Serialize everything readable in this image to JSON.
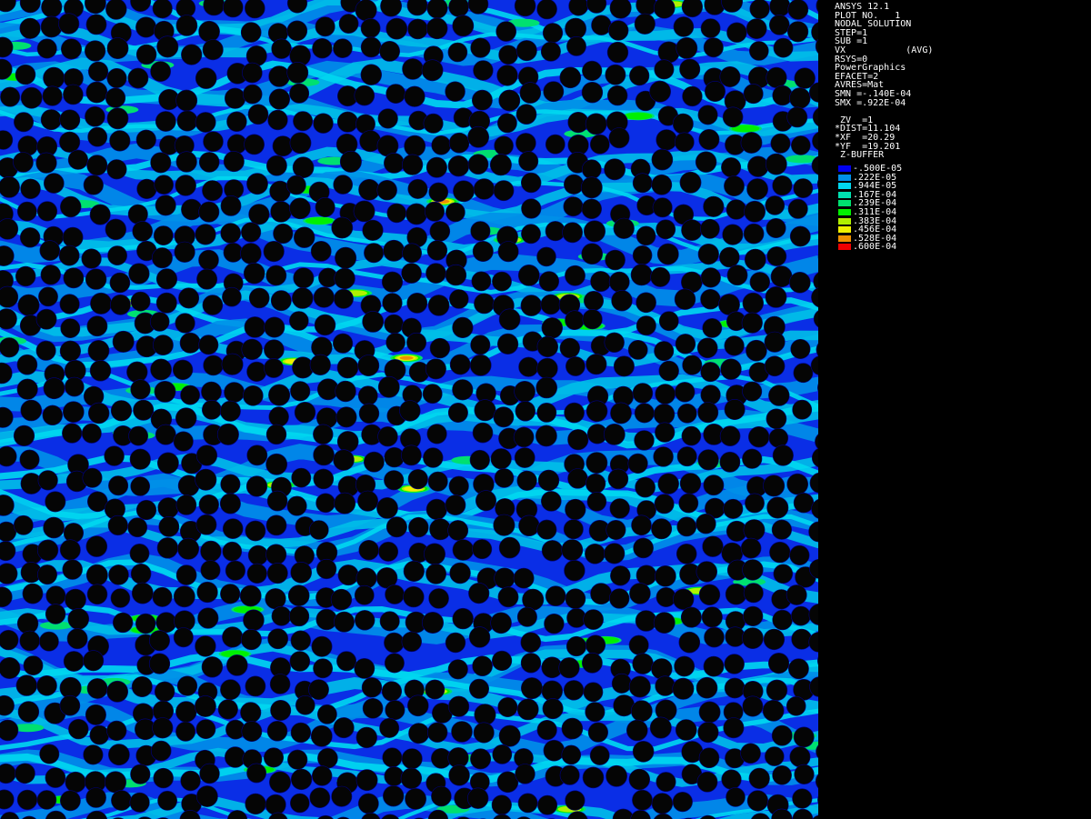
{
  "info": {
    "lines1": [
      "ANSYS 12.1",
      "PLOT NO.   1",
      "NODAL SOLUTION",
      "STEP=1",
      "SUB =1",
      "VX           (AVG)",
      "RSYS=0",
      "PowerGraphics",
      "EFACET=2",
      "AVRES=Mat",
      "SMN =-.140E-04",
      "SMX =.922E-04"
    ],
    "lines2": [
      " ZV  =1",
      "*DIST=11.104",
      "*XF  =20.29",
      "*YF  =19.201",
      " Z-BUFFER"
    ]
  },
  "legend": [
    {
      "label": "-.500E-05",
      "color": "#0000f0"
    },
    {
      "label": ".222E-05",
      "color": "#0090e8"
    },
    {
      "label": ".944E-05",
      "color": "#00d8f0"
    },
    {
      "label": ".167E-04",
      "color": "#00e0b0"
    },
    {
      "label": ".239E-04",
      "color": "#00e070"
    },
    {
      "label": ".311E-04",
      "color": "#00f000"
    },
    {
      "label": ".383E-04",
      "color": "#b0f000"
    },
    {
      "label": ".456E-04",
      "color": "#f0f000"
    },
    {
      "label": ".528E-04",
      "color": "#f09000"
    },
    {
      "label": ".600E-04",
      "color": "#f00000"
    }
  ],
  "colors": {
    "background": "#000000",
    "fluid_base": "#0a2ee6",
    "fiber": "#050505"
  }
}
